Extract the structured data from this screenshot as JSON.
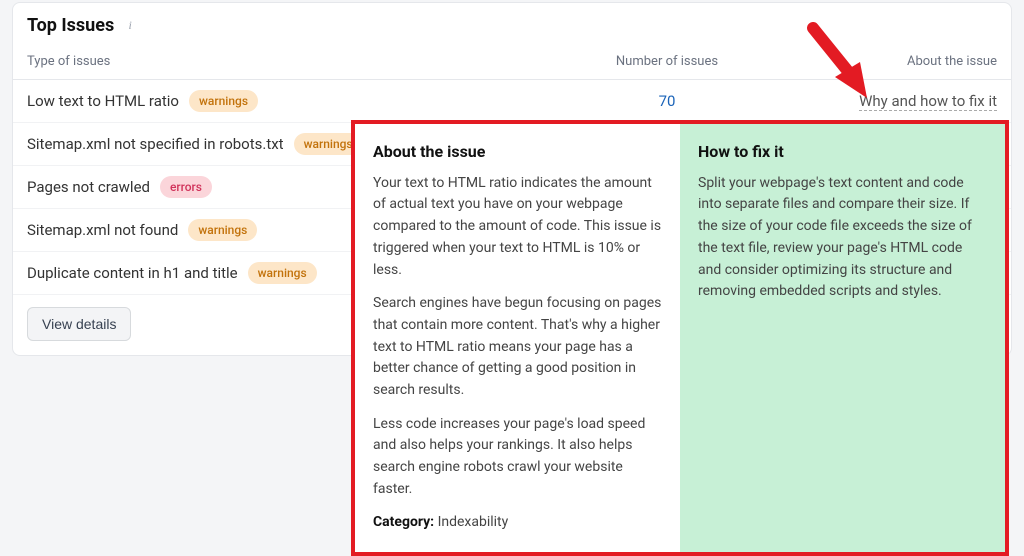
{
  "card": {
    "title": "Top Issues",
    "columns": {
      "type": "Type of issues",
      "number": "Number of issues",
      "about": "About the issue"
    },
    "view_details": "View details"
  },
  "issues": [
    {
      "name": "Low text to HTML ratio",
      "badge_type": "warnings",
      "badge_label": "warnings",
      "count": "70",
      "why": "Why and how to fix it"
    },
    {
      "name": "Sitemap.xml not specified in robots.txt",
      "badge_type": "warnings",
      "badge_label": "warnings",
      "count": "",
      "why": ""
    },
    {
      "name": "Pages not crawled",
      "badge_type": "errors",
      "badge_label": "errors",
      "count": "",
      "why": ""
    },
    {
      "name": "Sitemap.xml not found",
      "badge_type": "warnings",
      "badge_label": "warnings",
      "count": "",
      "why": ""
    },
    {
      "name": "Duplicate content in h1 and title",
      "badge_type": "warnings",
      "badge_label": "warnings",
      "count": "",
      "why": ""
    }
  ],
  "popup": {
    "about_title": "About the issue",
    "about_p1": "Your text to HTML ratio indicates the amount of actual text you have on your webpage compared to the amount of code. This issue is triggered when your text to HTML is 10% or less.",
    "about_p2": "Search engines have begun focusing on pages that contain more content. That's why a higher text to HTML ratio means your page has a better chance of getting a good position in search results.",
    "about_p3": "Less code increases your page's load speed and also helps your rankings. It also helps search engine robots crawl your website faster.",
    "category_label": "Category:",
    "category_value": " Indexability",
    "fix_title": "How to fix it",
    "fix_p1": "Split your webpage's text content and code into separate files and compare their size. If the size of your code file exceeds the size of the text file, review your page's HTML code and consider optimizing its structure and removing embedded scripts and styles."
  },
  "colors": {
    "accent_red": "#e31b23",
    "link_blue": "#1a63b8",
    "mint": "#c7f0d6"
  }
}
